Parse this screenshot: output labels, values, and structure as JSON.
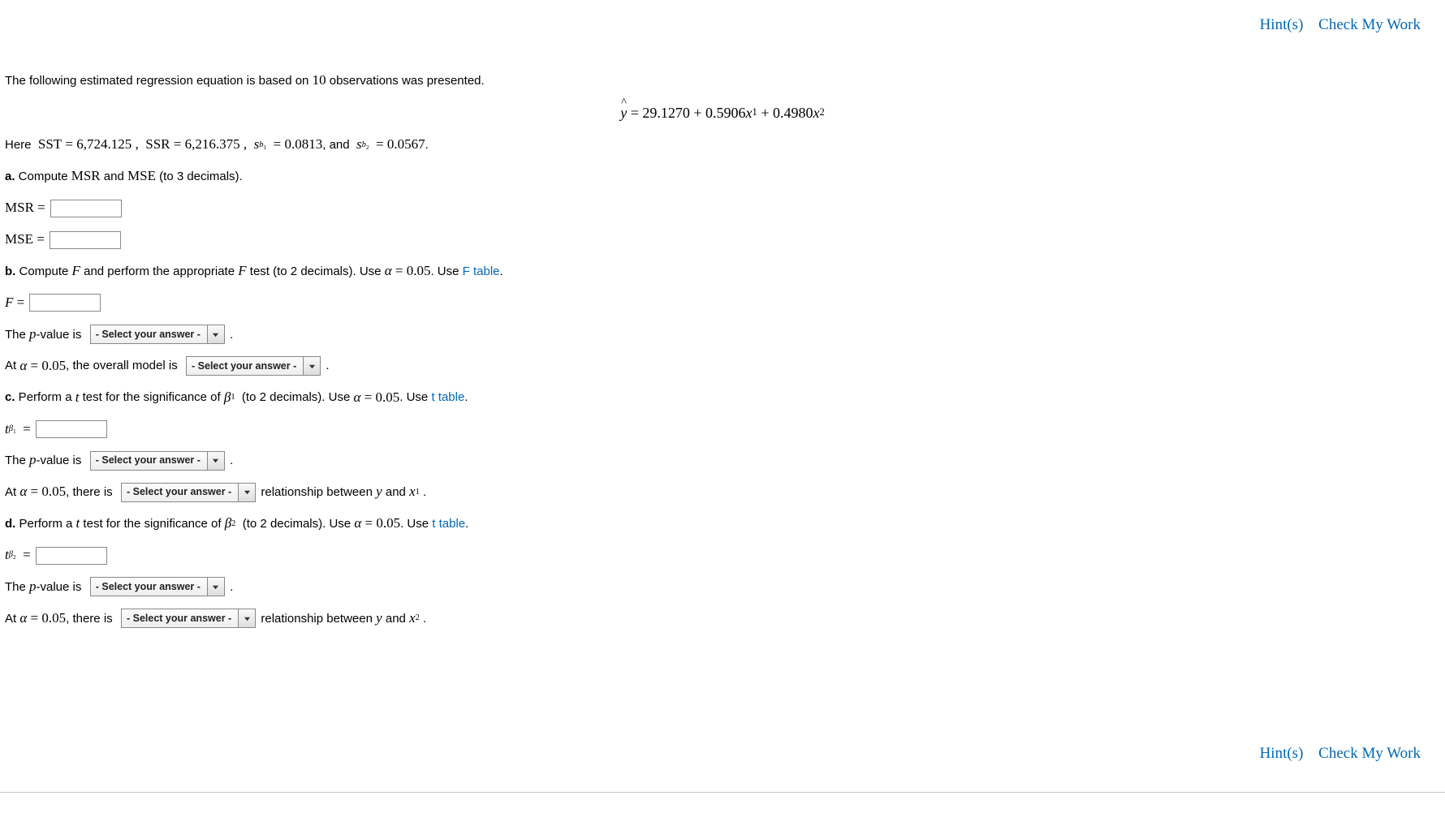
{
  "nav": {
    "hints": "Hint(s)",
    "check": "Check My Work"
  },
  "intro": {
    "prefix": "The following estimated regression equation is based on ",
    "n": "10",
    "suffix": " observations was presented."
  },
  "equation": {
    "lhs_var": "y",
    "eq": " = ",
    "b0": "29.1270",
    "plus1": " + ",
    "b1": "0.5906",
    "x1": "x",
    "x1_sub": "1",
    "plus2": " + ",
    "b2": "0.4980",
    "x2": "x",
    "x2_sub": "2"
  },
  "given": {
    "here": "Here  ",
    "sst_lbl": "SST",
    "eq1": " = ",
    "sst_val": "6,724.125",
    "sep1": " ,  ",
    "ssr_lbl": "SSR",
    "eq2": " = ",
    "ssr_val": "6,216.375",
    "sep2": " ,  ",
    "sb1_sym": "s",
    "sb1_sub": "b",
    "sb1_sub2": "1",
    "eq3": "  = ",
    "sb1_val": "0.0813",
    "and": ", and  ",
    "sb2_sym": "s",
    "sb2_sub": "b",
    "sb2_sub2": "2",
    "eq4": "  = ",
    "sb2_val": "0.0567",
    "end": "."
  },
  "a": {
    "tag": "a.",
    "text1": " Compute ",
    "msr": "MSR",
    "and": " and ",
    "mse": "MSE",
    "text2": " (to 3 decimals).",
    "msr_lbl": "MSR",
    "mse_lbl": "MSE",
    "eq": " = "
  },
  "b": {
    "tag": "b.",
    "text1": " Compute ",
    "F": "F",
    "text2": " and perform the appropriate ",
    "text3": " test (to 2 decimals). Use ",
    "alpha": "α",
    "eq": " = ",
    "alpha_val": "0.05",
    "use": ". Use ",
    "link": "F table",
    "dot": ".",
    "F_lbl": "F",
    "feq": " = ",
    "pval_pre": "The ",
    "p": "p",
    "pval_post": "-value is  ",
    "period": " .",
    "at_pre": "At ",
    "at_post": ", the overall model is  "
  },
  "c": {
    "tag": "c.",
    "text1": " Perform a ",
    "t": "t",
    "text2": " test for the significance of ",
    "beta": "β",
    "beta_sub": "1",
    "text3": "  (to 2 decimals). Use ",
    "alpha": "α",
    "eq": " = ",
    "alpha_val": "0.05",
    "use": ". Use ",
    "link": "t table",
    "dot": ".",
    "tstat_sym": "t",
    "tstat_sub": "β",
    "tstat_sub2": "1",
    "tstat_eq": "  = ",
    "pval_pre": "The ",
    "p": "p",
    "pval_post": "-value is  ",
    "period": " .",
    "at_pre": "At ",
    "at_mid": ", there is  ",
    "rel": " relationship between ",
    "y": "y",
    "and": " and ",
    "x": "x",
    "xsub": "1",
    "end": " ."
  },
  "d": {
    "tag": "d.",
    "text1": " Perform a ",
    "t": "t",
    "text2": " test for the significance of ",
    "beta": "β",
    "beta_sub": "2",
    "text3": "  (to 2 decimals). Use ",
    "alpha": "α",
    "eq": " = ",
    "alpha_val": "0.05",
    "use": ". Use ",
    "link": "t table",
    "dot": ".",
    "tstat_sym": "t",
    "tstat_sub": "β",
    "tstat_sub2": "2",
    "tstat_eq": "  = ",
    "pval_pre": "The ",
    "p": "p",
    "pval_post": "-value is  ",
    "period": " .",
    "at_pre": "At ",
    "at_mid": ", there is  ",
    "rel": " relationship between ",
    "y": "y",
    "and": " and ",
    "x": "x",
    "xsub": "2",
    "end": " ."
  },
  "dropdown": {
    "placeholder": "- Select your answer -"
  }
}
